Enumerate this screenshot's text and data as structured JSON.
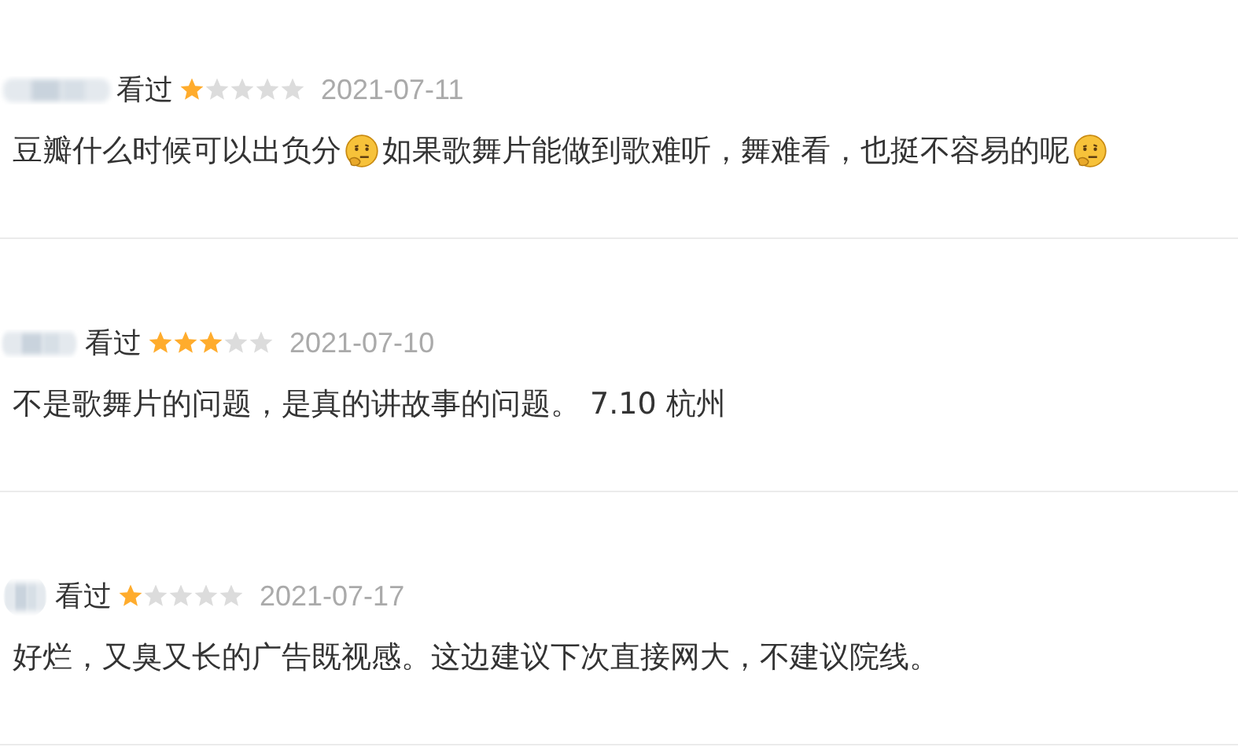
{
  "reviews": [
    {
      "status": "看过",
      "stars": 1,
      "date": "2021-07-11",
      "segments": [
        {
          "kind": "text",
          "text": "豆瓣什么时候可以出负分"
        },
        {
          "kind": "emoji"
        },
        {
          "kind": "text",
          "text": "如果歌舞片能做到歌难听，舞难看，也挺不容易的呢"
        },
        {
          "kind": "emoji"
        }
      ]
    },
    {
      "status": "看过",
      "stars": 3,
      "date": "2021-07-10",
      "segments": [
        {
          "kind": "text",
          "text": "不是歌舞片的问题，是真的讲故事的问题。 7.10 杭州"
        }
      ]
    },
    {
      "status": "看过",
      "stars": 1,
      "date": "2021-07-17",
      "segments": [
        {
          "kind": "text",
          "text": "好烂，又臭又长的广告既视感。这边建议下次直接网大，不建议院线。"
        }
      ]
    }
  ]
}
